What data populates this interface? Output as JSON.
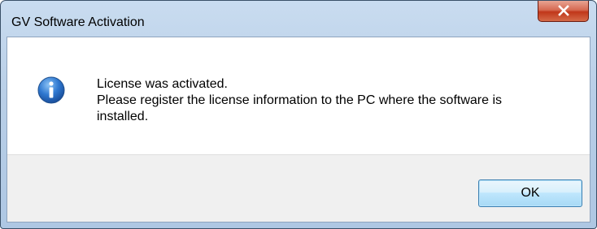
{
  "window": {
    "title": "GV Software Activation",
    "close_icon": "close-icon"
  },
  "message": {
    "icon": "info-icon",
    "line1": "License was activated.",
    "line2": "Please register the license information to the PC where the software is",
    "line3": "installed."
  },
  "buttons": {
    "ok_label": "OK"
  },
  "colors": {
    "titlebar": "#b9cfe7",
    "close_button": "#c0371a",
    "button_area": "#f0f0f0",
    "ok_button_border": "#3c7fb1",
    "info_icon": "#1f5fb8"
  }
}
